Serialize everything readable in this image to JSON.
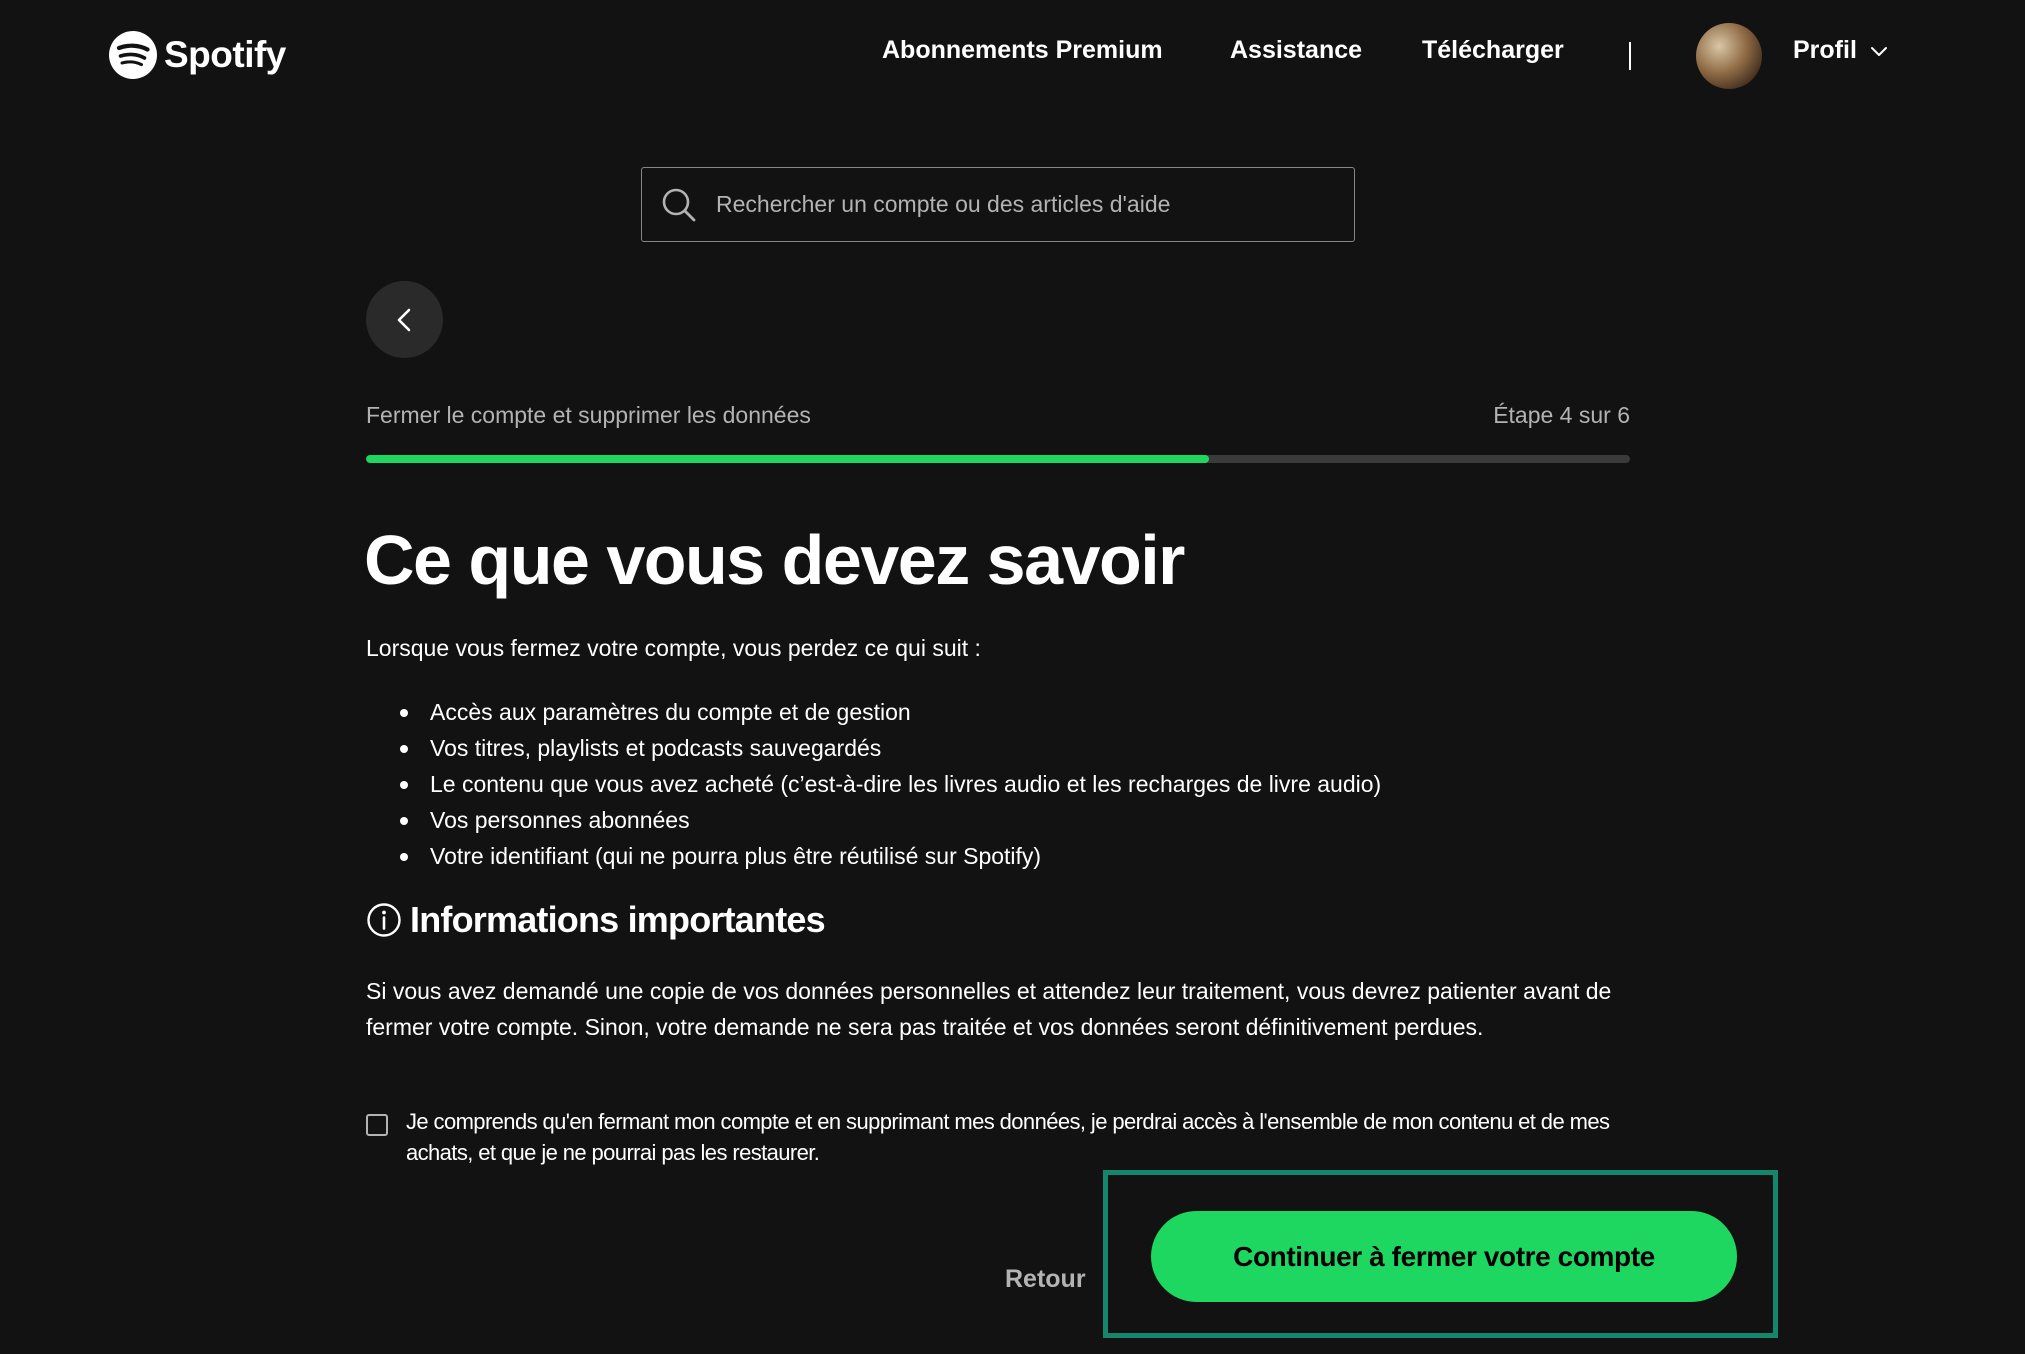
{
  "header": {
    "logo_text": "Spotify",
    "nav": [
      {
        "label": "Abonnements Premium"
      },
      {
        "label": "Assistance"
      },
      {
        "label": "Télécharger"
      }
    ],
    "profile_label": "Profil"
  },
  "search": {
    "placeholder": "Rechercher un compte ou des articles d'aide",
    "value": ""
  },
  "progress": {
    "title": "Fermer le compte et supprimer les données",
    "step_text": "Étape 4 sur 6",
    "fill_fraction": 0.667
  },
  "content": {
    "heading": "Ce que vous devez savoir",
    "intro": "Lorsque vous fermez votre compte, vous perdez ce qui suit :",
    "losses": [
      "Accès aux paramètres du compte et de gestion",
      "Vos titres, playlists et podcasts sauvegardés",
      "Le contenu que vous avez acheté (c’est-à-dire les livres audio et les recharges de livre audio)",
      "Vos personnes abonnées",
      "Votre identifiant (qui ne pourra plus être réutilisé sur Spotify)"
    ],
    "info_heading": "Informations importantes",
    "info_paragraph": "Si vous avez demandé une copie de vos données personnelles et attendez leur traitement, vous devrez patienter avant de fermer votre compte. Sinon, votre demande ne sera pas traitée et vos données seront définitivement perdues.",
    "consent_text": "Je comprends qu'en fermant mon compte et en supprimant mes données, je perdrai accès à l'ensemble de mon contenu et de mes achats, et que je ne pourrai pas les restaurer.",
    "consent_checked": false
  },
  "actions": {
    "back_label": "Retour",
    "continue_label": "Continuer à fermer votre compte"
  },
  "colors": {
    "background": "#121212",
    "accent": "#1ed760",
    "highlight_border": "#14876a",
    "muted_text": "#b3b3b3"
  },
  "icons": {
    "logo": "spotify-logo-icon",
    "search": "search-icon",
    "back": "chevron-left-icon",
    "profile_dropdown": "chevron-down-icon",
    "info": "info-icon"
  }
}
